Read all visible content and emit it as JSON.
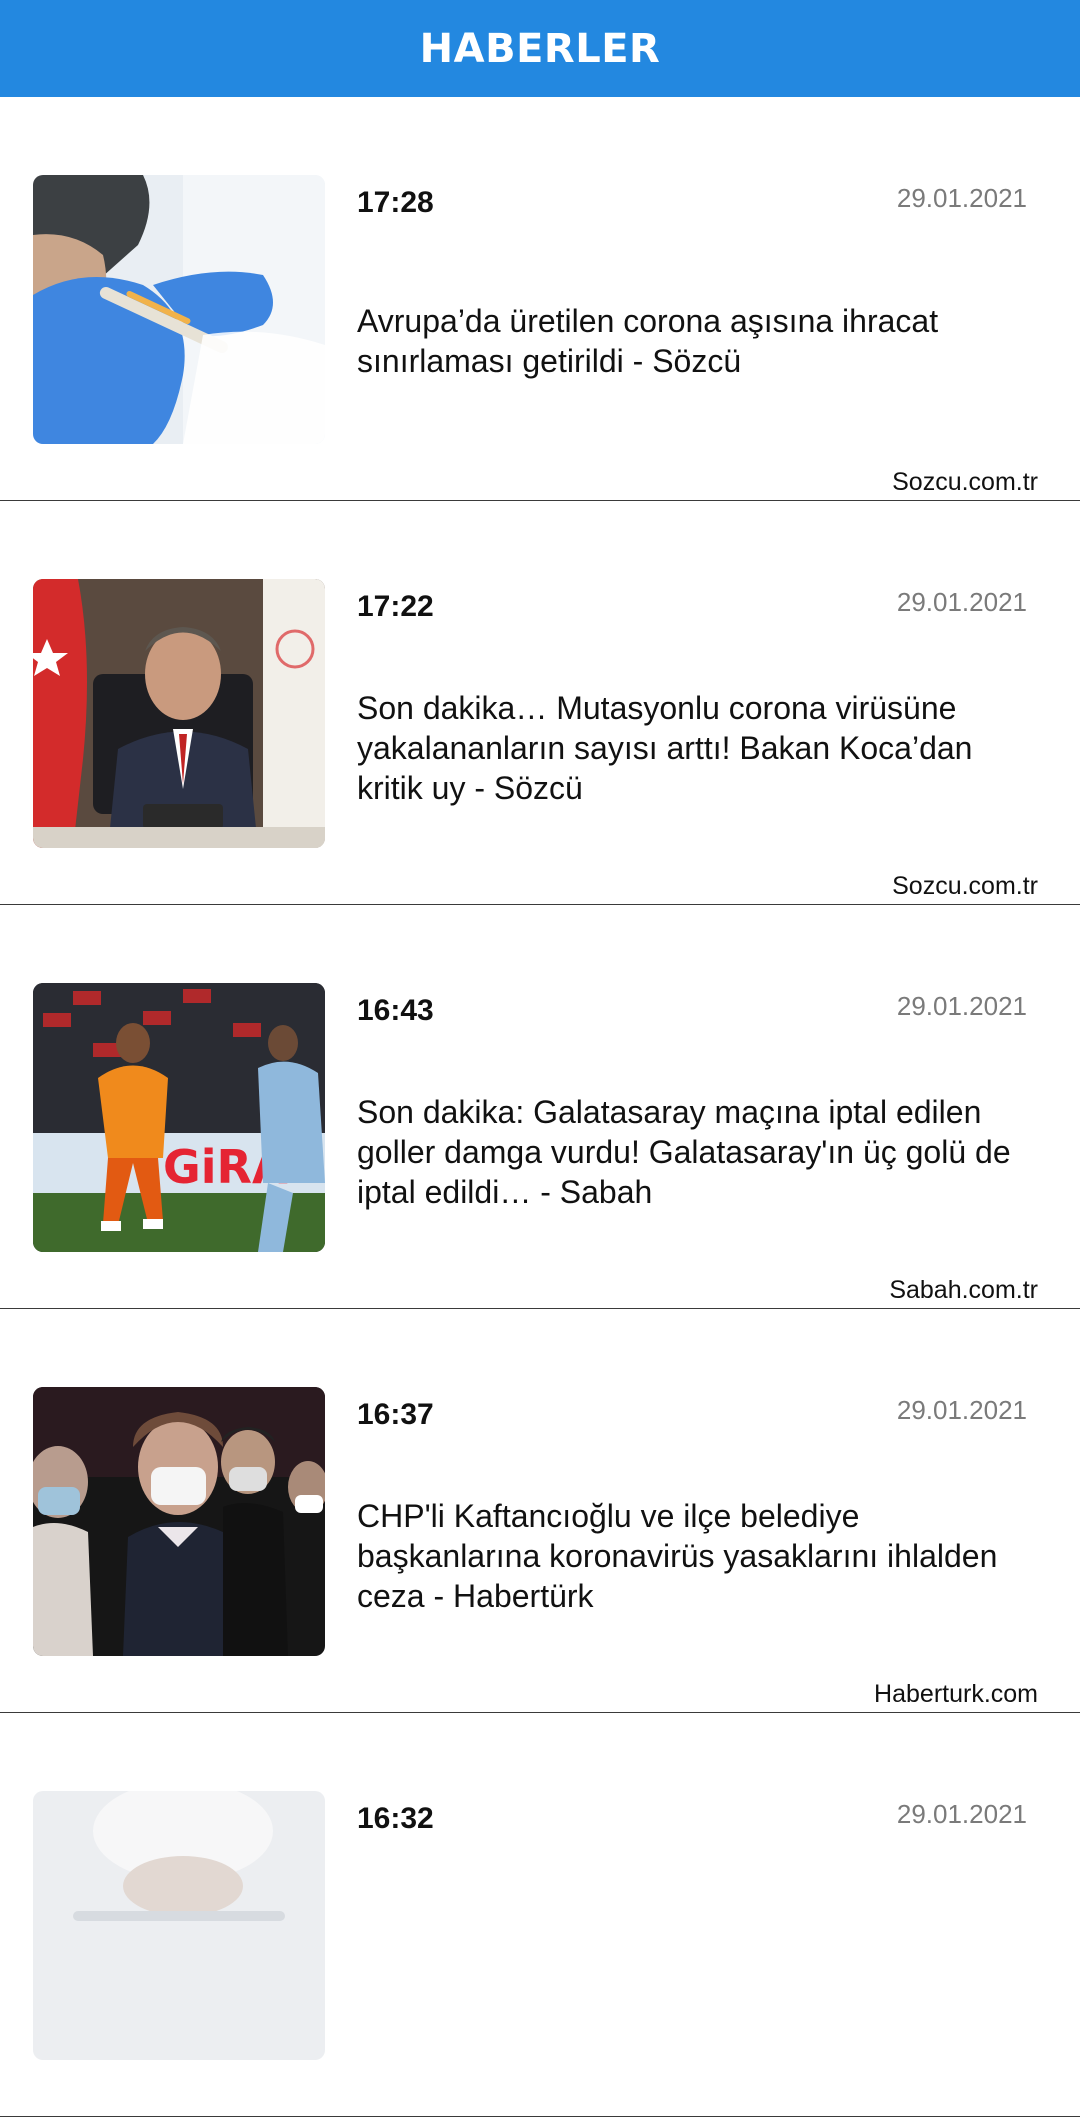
{
  "header": {
    "title": "HABERLER",
    "color": "#2388e0"
  },
  "news": [
    {
      "time": "17:28",
      "date": "29.01.2021",
      "headline": "Avrupa’da üretilen corona aşısına ihracat sınırlaması getirildi - Sözcü",
      "source": "Sozcu.com.tr",
      "thumbnail_icon": "vaccine-injection-photo"
    },
    {
      "time": "17:22",
      "date": "29.01.2021",
      "headline": "Son dakika… Mutasyonlu corona virüsüne yakalananların sayısı arttı! Bakan Koca’dan kritik uy - Sözcü",
      "source": "Sozcu.com.tr",
      "thumbnail_icon": "minister-press-conference-photo"
    },
    {
      "time": "16:43",
      "date": "29.01.2021",
      "headline": "Son dakika: Galatasaray maçına iptal edilen goller damga vurdu! Galatasaray'ın üç golü de iptal edildi… - Sabah",
      "source": "Sabah.com.tr",
      "thumbnail_icon": "football-match-photo",
      "thumbnail_text": "GiRA"
    },
    {
      "time": "16:37",
      "date": "29.01.2021",
      "headline": "CHP'li Kaftancıoğlu ve ilçe belediye başkanlarına koronavirüs yasaklarını ihlalden ceza - Habertürk",
      "source": "Haberturk.com",
      "thumbnail_icon": "masked-people-photo"
    },
    {
      "time": "16:32",
      "date": "29.01.2021",
      "headline": "",
      "source": "",
      "thumbnail_icon": "partial-photo"
    }
  ]
}
